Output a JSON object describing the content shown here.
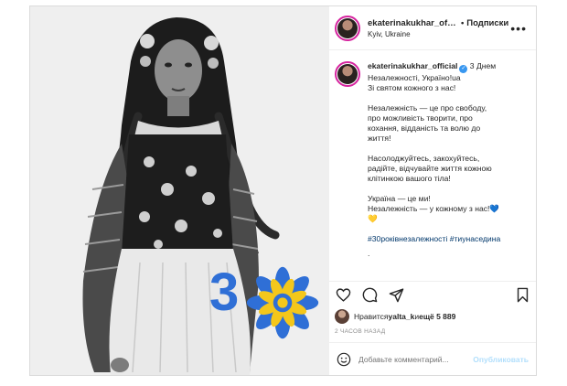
{
  "header": {
    "username": "ekaterinakukhar_offici",
    "separator": "•",
    "follow_label": "Подписки",
    "location": "Kyiv, Ukraine",
    "more_icon": "ellipsis-icon"
  },
  "caption": {
    "username": "ekaterinakukhar_official",
    "verified_icon": "verified-badge-icon",
    "line1_text": " 3 Днем",
    "line2": "Незалежності, Україно!ua",
    "line3": "Зі святом кожного з нас!",
    "para2": "Незалежність — це про свободу,\nпро можливість творити, про\nкохання, відданість та волю до\nжиття!",
    "para3": "Насолоджуйтесь, закохуйтесь,\nрадійте, відчувайте життя кожною\nклітинкою вашого тіла!",
    "para4_l1": "Україна — це ми!",
    "para4_l2": "Незалежність — у кожному з нас!",
    "blue_heart": "💙",
    "yellow_heart": "💛",
    "hashtags": "#30роківнезалежності #тиунаседина",
    "trailing": "."
  },
  "actions": {
    "like_icon": "heart-icon",
    "comment_icon": "comment-icon",
    "share_icon": "send-icon",
    "save_icon": "bookmark-icon"
  },
  "likes": {
    "prefix": "Нравится ",
    "user": "yalta_k",
    "middle": " и ",
    "count": "ещё 5 889"
  },
  "timestamp": "2 ЧАСОВ НАЗАД",
  "comment_box": {
    "placeholder": "Добавьте комментарий...",
    "publish_label": "Опубликовать",
    "emoji_icon": "smiley-icon"
  },
  "media": {
    "badge_number": "30",
    "badge_color_blue": "#2f6fd6",
    "badge_color_yellow": "#f4c71b"
  }
}
